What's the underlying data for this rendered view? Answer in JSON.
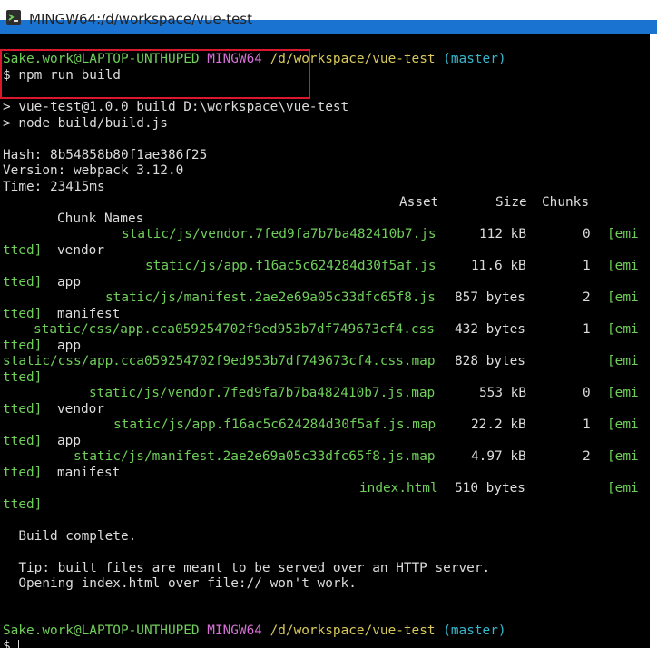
{
  "window": {
    "title": "MINGW64:/d/workspace/vue-test"
  },
  "prompt1": {
    "user": "Sake.work@LAPTOP-UNTHUPED",
    "env": "MINGW64",
    "path": "/d/workspace/vue-test",
    "branch": "(master)"
  },
  "cmd": "$ npm run build",
  "out_npm1": "> vue-test@1.0.0 build D:\\workspace\\vue-test",
  "out_npm2": "> node build/build.js",
  "hash": "Hash: 8b54858b80f1ae386f25",
  "version": "Version: webpack 3.12.0",
  "time": "Time: 23415ms",
  "table_header": {
    "asset": "Asset",
    "size": "Size",
    "chunks": "Chunks",
    "chunk_names": "Chunk Names",
    "emitted_start": "[emi",
    "emitted_end": "tted]"
  },
  "assets": [
    {
      "name": "static/js/vendor.7fed9fa7b7ba482410b7.js",
      "size": "112 kB",
      "chunk": "0",
      "chunk_name": "vendor"
    },
    {
      "name": "static/js/app.f16ac5c624284d30f5af.js",
      "size": "11.6 kB",
      "chunk": "1",
      "chunk_name": "app"
    },
    {
      "name": "static/js/manifest.2ae2e69a05c33dfc65f8.js",
      "size": "857 bytes",
      "chunk": "2",
      "chunk_name": "manifest"
    },
    {
      "name": "static/css/app.cca059254702f9ed953b7df749673cf4.css",
      "size": "432 bytes",
      "chunk": "1",
      "chunk_name": "app"
    },
    {
      "name": "static/css/app.cca059254702f9ed953b7df749673cf4.css.map",
      "size": "828 bytes",
      "chunk": "",
      "chunk_name": ""
    },
    {
      "name": "static/js/vendor.7fed9fa7b7ba482410b7.js.map",
      "size": "553 kB",
      "chunk": "0",
      "chunk_name": "vendor"
    },
    {
      "name": "static/js/app.f16ac5c624284d30f5af.js.map",
      "size": "22.2 kB",
      "chunk": "1",
      "chunk_name": "app"
    },
    {
      "name": "static/js/manifest.2ae2e69a05c33dfc65f8.js.map",
      "size": "4.97 kB",
      "chunk": "2",
      "chunk_name": "manifest"
    },
    {
      "name": "index.html",
      "size": "510 bytes",
      "chunk": "",
      "chunk_name": ""
    }
  ],
  "build_complete": "  Build complete.",
  "tip1": "  Tip: built files are meant to be served over an HTTP server.",
  "tip2": "  Opening index.html over file:// won't work.",
  "prompt2": {
    "user": "Sake.work@LAPTOP-UNTHUPED",
    "env": "MINGW64",
    "path": "/d/workspace/vue-test",
    "branch": "(master)"
  },
  "final_prompt": "$",
  "colors": {
    "green": "#6fcf5a",
    "magenta": "#d670d6",
    "yellow": "#d8c95a",
    "cyan": "#36b6cc",
    "highlight": "#d9182e"
  }
}
